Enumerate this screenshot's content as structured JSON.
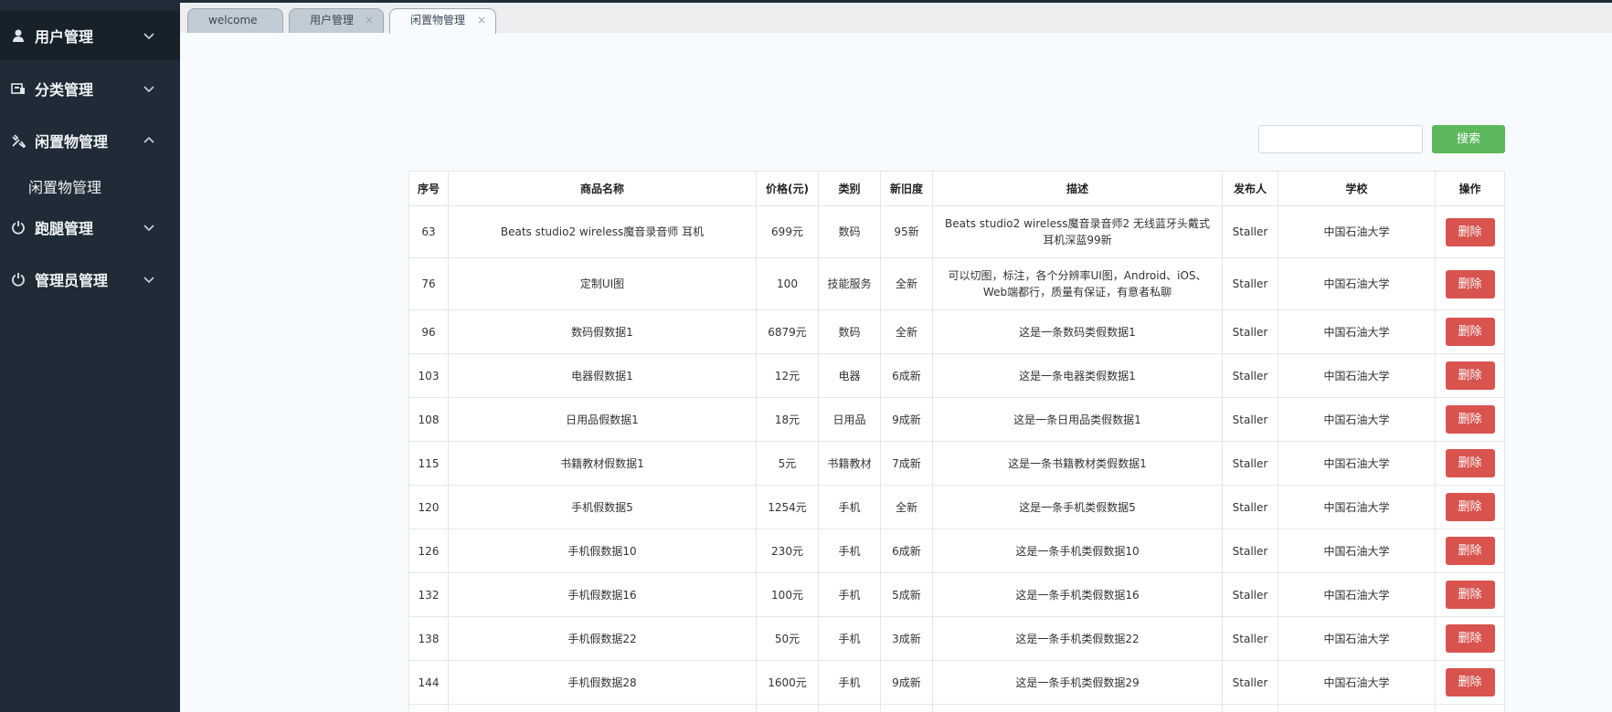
{
  "sidebar": {
    "groups": [
      {
        "label": "用户管理",
        "icon": "user-icon",
        "expanded": false
      },
      {
        "label": "分类管理",
        "icon": "category-icon",
        "expanded": false
      },
      {
        "label": "闲置物管理",
        "icon": "tools-icon",
        "expanded": true,
        "sub": "闲置物管理"
      },
      {
        "label": "跑腿管理",
        "icon": "power-icon",
        "expanded": false
      },
      {
        "label": "管理员管理",
        "icon": "power-icon",
        "expanded": false
      }
    ]
  },
  "tabs": [
    {
      "label": "welcome"
    },
    {
      "label": "用户管理"
    },
    {
      "label": "闲置物管理"
    }
  ],
  "search": {
    "placeholder": "",
    "button": "搜索"
  },
  "table": {
    "headers": [
      "序号",
      "商品名称",
      "价格(元)",
      "类别",
      "新旧度",
      "描述",
      "发布人",
      "学校",
      "操作"
    ],
    "delete_label": "删除",
    "rows": [
      [
        "63",
        "Beats studio2 wireless魔音录音师 耳机",
        "699元",
        "数码",
        "95新",
        "Beats studio2 wireless魔音录音师2 无线蓝牙头戴式耳机深蓝99新",
        "Staller",
        "中国石油大学"
      ],
      [
        "76",
        "定制UI图",
        "100",
        "技能服务",
        "全新",
        "可以切图，标注，各个分辨率UI图，Android、iOS、Web端都行，质量有保证，有意者私聊",
        "Staller",
        "中国石油大学"
      ],
      [
        "96",
        "数码假数据1",
        "6879元",
        "数码",
        "全新",
        "这是一条数码类假数据1",
        "Staller",
        "中国石油大学"
      ],
      [
        "103",
        "电器假数据1",
        "12元",
        "电器",
        "6成新",
        "这是一条电器类假数据1",
        "Staller",
        "中国石油大学"
      ],
      [
        "108",
        "日用品假数据1",
        "18元",
        "日用品",
        "9成新",
        "这是一条日用品类假数据1",
        "Staller",
        "中国石油大学"
      ],
      [
        "115",
        "书籍教材假数据1",
        "5元",
        "书籍教材",
        "7成新",
        "这是一条书籍教材类假数据1",
        "Staller",
        "中国石油大学"
      ],
      [
        "120",
        "手机假数据5",
        "1254元",
        "手机",
        "全新",
        "这是一条手机类假数据5",
        "Staller",
        "中国石油大学"
      ],
      [
        "126",
        "手机假数据10",
        "230元",
        "手机",
        "6成新",
        "这是一条手机类假数据10",
        "Staller",
        "中国石油大学"
      ],
      [
        "132",
        "手机假数据16",
        "100元",
        "手机",
        "5成新",
        "这是一条手机类假数据16",
        "Staller",
        "中国石油大学"
      ],
      [
        "138",
        "手机假数据22",
        "50元",
        "手机",
        "3成新",
        "这是一条手机类假数据22",
        "Staller",
        "中国石油大学"
      ],
      [
        "144",
        "手机假数据28",
        "1600元",
        "手机",
        "9成新",
        "这是一条手机类假数据29",
        "Staller",
        "中国石油大学"
      ]
    ]
  },
  "colors": {
    "sidebar": "#1f2b36",
    "search_button": "#5cb85c",
    "delete_button": "#d9534f"
  }
}
